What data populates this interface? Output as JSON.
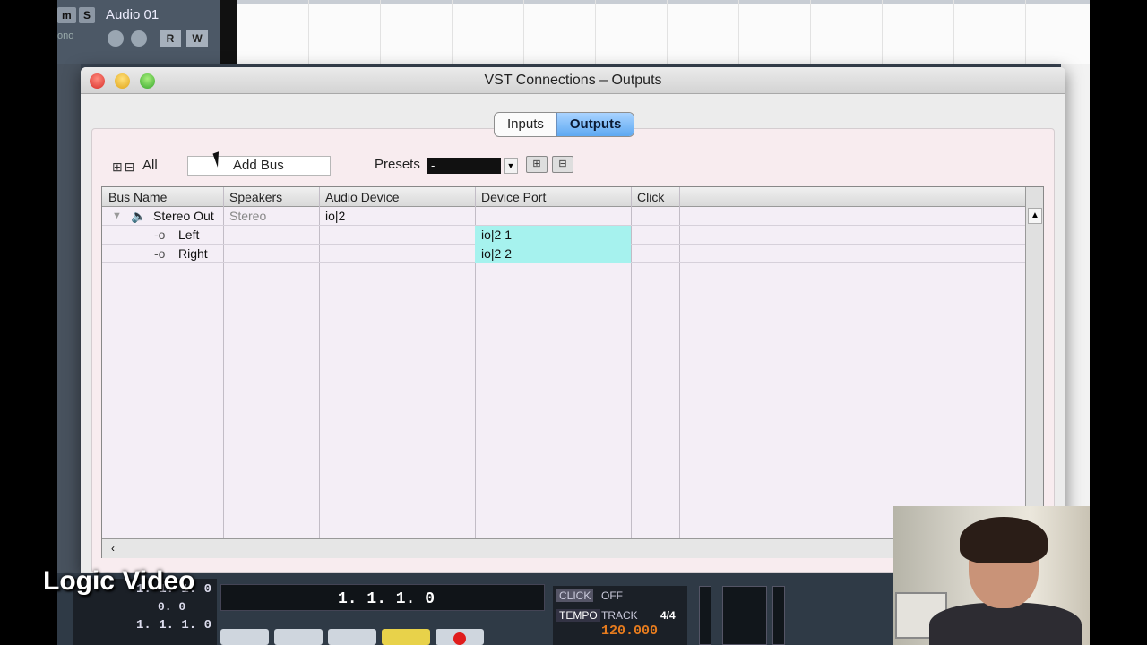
{
  "daw": {
    "track_name": "Audio 01",
    "m_label": "m",
    "s_label": "S",
    "mono_label": "ono",
    "r_label": "R",
    "w_label": "W"
  },
  "window": {
    "title": "VST Connections – Outputs",
    "tabs": [
      {
        "label": "Inputs",
        "active": false
      },
      {
        "label": "Outputs",
        "active": true
      }
    ]
  },
  "toolbar": {
    "expand_icons": "⊞⊟",
    "all_label": "All",
    "add_bus_label": "Add Bus",
    "presets_label": "Presets",
    "presets_value": "-"
  },
  "table": {
    "columns": [
      "Bus Name",
      "Speakers",
      "Audio Device",
      "Device Port",
      "Click"
    ],
    "rows": [
      {
        "bus_name": "Stereo Out",
        "speakers": "Stereo",
        "audio_device": "io|2",
        "device_port": "",
        "click": ""
      },
      {
        "bus_name": "Left",
        "speakers": "",
        "audio_device": "",
        "device_port": "io|2 1",
        "click": ""
      },
      {
        "bus_name": "Right",
        "speakers": "",
        "audio_device": "",
        "device_port": "io|2 2",
        "click": ""
      }
    ]
  },
  "transport": {
    "left_readouts": [
      "1. 1. 1.  0",
      "0.  0",
      "1. 1. 1.  0"
    ],
    "position": "1. 1. 1.   0",
    "click_label": "CLICK",
    "click_value": "OFF",
    "tempo_label": "TEMPO",
    "track_label": "TRACK",
    "signature": "4/4",
    "tempo_value": "120.000"
  },
  "overlay_caption": "Logic Video",
  "colors": {
    "port_highlight": "#a6f2ee",
    "tab_active": "#5ea9f2",
    "record": "#e01c1c",
    "tempo": "#e57b1e"
  }
}
